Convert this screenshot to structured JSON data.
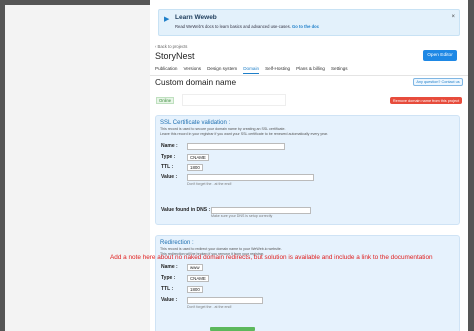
{
  "banner": {
    "title": "Learn Weweb",
    "text": "Read WeWeb's docs to learn basics and advanced use-cases.",
    "link": "Go to the doc",
    "close_glyph": "×"
  },
  "header": {
    "back": "‹ Back to projects",
    "project": "StoryNest",
    "open_editor": "Open Editor"
  },
  "tabs": [
    "Publication",
    "Versions",
    "Design system",
    "Domain",
    "Self-Hosting",
    "Plans & billing",
    "Settings"
  ],
  "active_tab": "Domain",
  "domain": {
    "title": "Custom domain name",
    "question_button": "Any question? Contact us",
    "status": "Online",
    "remove_button": "Remove domain name from this project"
  },
  "ssl": {
    "title": "SSL Certificate validation :",
    "desc1": "This record is used to secure your domain name by creating an SSL certificate.",
    "desc2": "Leave this record in your registrar if you want your SSL certificate to be renewed automatically every year.",
    "name_label": "Name :",
    "name_value": "",
    "type_label": "Type :",
    "type_value": "CNAME",
    "ttl_label": "TTL :",
    "ttl_value": "1800",
    "value_label": "Value :",
    "value_value": "",
    "value_hint": "Don't forget the . at the end!",
    "dns_label": "Value found in DNS :",
    "dns_value": "",
    "dns_hint": "Make sure your DNS is setup correctly"
  },
  "redirection": {
    "title": "Redirection :",
    "desc1": "This record is used to redirect your domain name to your WeWeb.io website.",
    "desc2": "This redirection will be broken if you remove it from your registrar.",
    "name_label": "Name :",
    "name_value": "www",
    "type_label": "Type :",
    "type_value": "CNAME",
    "ttl_label": "TTL :",
    "ttl_value": "1800",
    "value_label": "Value :",
    "value_value": "",
    "value_hint": "Don't forget the . at the end!"
  },
  "annotation": "Add a note here about no naked domain redirects, but solution is available and include a link to the documentation",
  "colors": {
    "accent": "#1e88e5",
    "danger": "#e74c3c",
    "card_bg": "#e6f2fd",
    "note": "#e02020"
  }
}
